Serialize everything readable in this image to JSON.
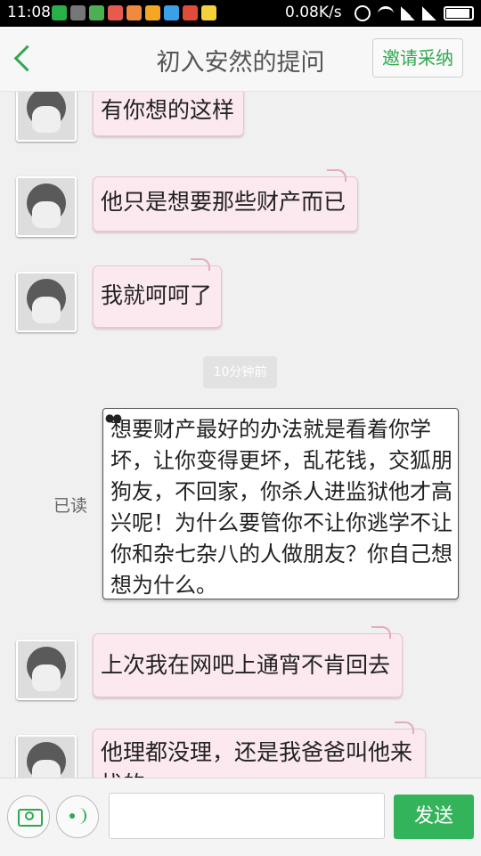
{
  "status_bar": {
    "time": "11:08",
    "network_speed": "0.08K/s"
  },
  "header": {
    "title": "初入安然的提问",
    "invite_label": "邀请采纳"
  },
  "chat": {
    "messages_in_1": [
      "有你想的这样",
      "他只是想要那些财产而已",
      "我就呵呵了"
    ],
    "time_tag": "10分钟前",
    "outgoing": {
      "read_status": "已读",
      "text": "想要财产最好的办法就是看着你学坏，让你变得更坏，乱花钱，交狐朋狗友，不回家，你杀人进监狱他才高兴呢！为什么要管你不让你逃学不让你和杂七杂八的人做朋友？你自己想想为什么。"
    },
    "messages_in_2": [
      "上次我在网吧上通宵不肯回去",
      "他理都没理，还是我爸爸叫他来找的"
    ]
  },
  "input_bar": {
    "placeholder": "",
    "send_label": "发送"
  }
}
